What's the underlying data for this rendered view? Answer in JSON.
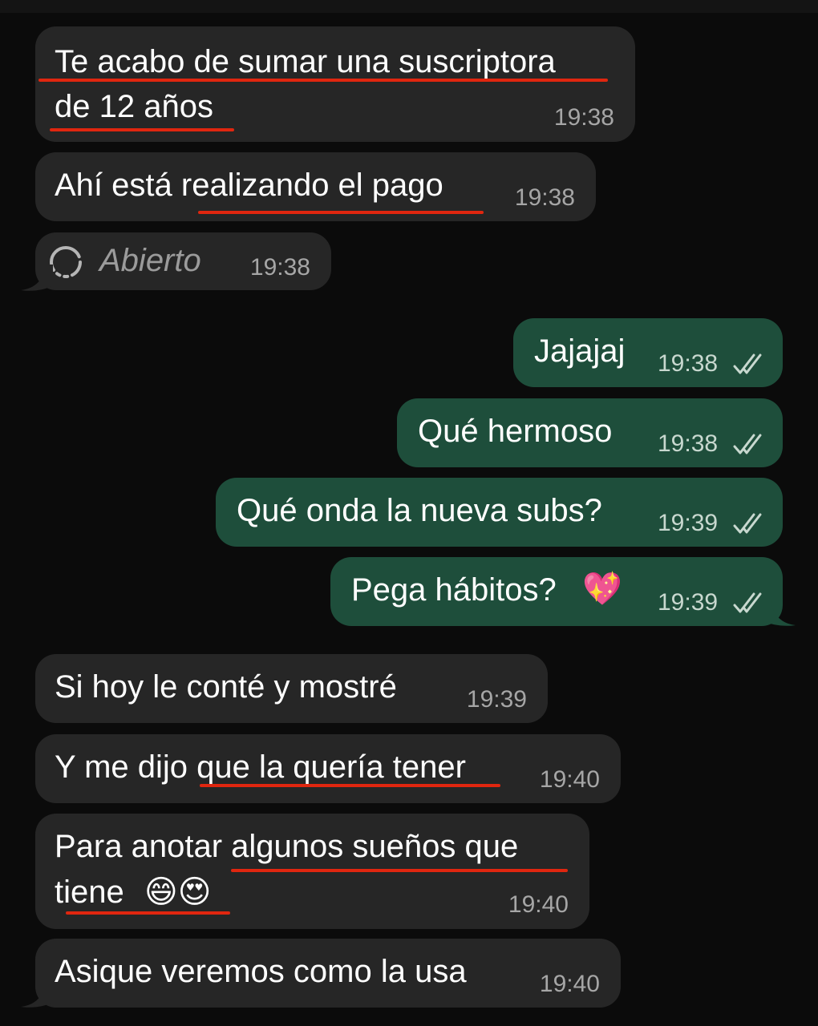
{
  "colors": {
    "background": "#0b0b0b",
    "incoming_bubble": "#262626",
    "outgoing_bubble": "#1e4e3b",
    "underline": "#e0260f",
    "timestamp": "#a6a6a6"
  },
  "messages": [
    {
      "direction": "incoming",
      "lines": [
        "Te acabo de sumar una suscriptora",
        "de 12 años"
      ],
      "time": "19:38"
    },
    {
      "direction": "incoming",
      "text": "Ahí está realizando el pago",
      "time": "19:38"
    },
    {
      "direction": "incoming",
      "text": "Abierto",
      "time": "19:38",
      "icon": "view-once-icon"
    },
    {
      "direction": "outgoing",
      "text": "Jajajaj",
      "time": "19:38",
      "status": "read-double-check"
    },
    {
      "direction": "outgoing",
      "text": "Qué hermoso",
      "time": "19:38",
      "status": "read-double-check"
    },
    {
      "direction": "outgoing",
      "text": "Qué onda la nueva subs?",
      "time": "19:39",
      "status": "read-double-check"
    },
    {
      "direction": "outgoing",
      "text": "Pega hábitos?",
      "emoji": "💖",
      "time": "19:39",
      "status": "read-double-check"
    },
    {
      "direction": "incoming",
      "text": "Si hoy le conté y mostré",
      "time": "19:39"
    },
    {
      "direction": "incoming",
      "text": "Y me dijo que la quería tener",
      "time": "19:40"
    },
    {
      "direction": "incoming",
      "lines": [
        "Para anotar algunos sueños que",
        "tiene"
      ],
      "emoji": "😄😍",
      "time": "19:40"
    },
    {
      "direction": "incoming",
      "text": "Asique veremos como la usa",
      "time": "19:40"
    }
  ]
}
